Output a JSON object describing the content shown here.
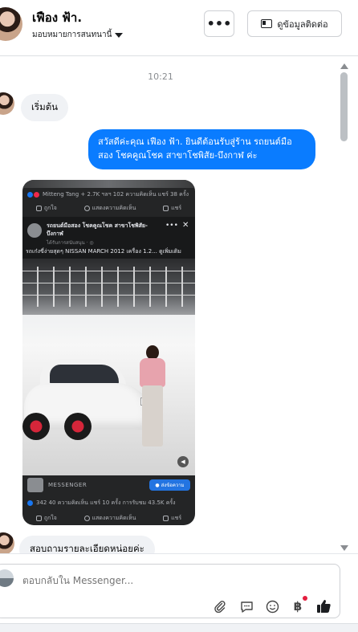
{
  "header": {
    "contact_name": "เฟือง ฟ้า.",
    "assign_label": "มอบหมายการสนทนานี้",
    "more_label": "•••",
    "contact_info_button": "ดูข้อมูลติดต่อ"
  },
  "thread": {
    "timestamp": "10:21",
    "messages": [
      {
        "from": "customer",
        "text": "เริ่มต้น"
      },
      {
        "from": "page",
        "text": "สวัสดีค่ะคุณ เฟือง ฟ้า. ยินดีต้อนรับสู่ร้าน รถยนต์มือสอง โชคคูณโชค สาขาโชพิสัย-บึงกาฬ ค่ะ"
      },
      {
        "from": "customer",
        "text": "สอบถามรายละเอียดหน่อยค่ะ"
      }
    ],
    "shared_post": {
      "top_meta": "Mitteng Tang + 2.7K ฯลฯ   102 ความคิดเห็น  แชร์ 38 ครั้ง",
      "actions": [
        "ถูกใจ",
        "แสดงความคิดเห็น",
        "แชร์"
      ],
      "post_name": "รถยนต์มือสอง โชคคูณโชค สาขาโชพิสัย-บึงกาฬ",
      "post_sub": "ได้รับการสนับสนุน · ◎",
      "caption": "รถเก๋งขี่ง่ายสุดๆ NISSAN MARCH 2012 เครื่อง 1.2... ดูเพิ่มเติม",
      "plate": "TT",
      "messenger_label": "MESSENGER",
      "send_message_button": "ส่งข้อความ",
      "bottom_meta": "342   40 ความคิดเห็น  แชร์ 10 ครั้ง  การรับชม 43.5K ครั้ง",
      "bottom_actions": [
        "ถูกใจ",
        "แสดงความคิดเห็น",
        "แชร์"
      ]
    }
  },
  "composer": {
    "placeholder": "ตอบกลับใน Messenger...",
    "tools": [
      "paperclip-icon",
      "chat-bubble-icon",
      "emoji-icon",
      "baht-icon",
      "thumbs-up-icon"
    ],
    "baht_symbol": "฿",
    "accent": "#0a7cff"
  }
}
